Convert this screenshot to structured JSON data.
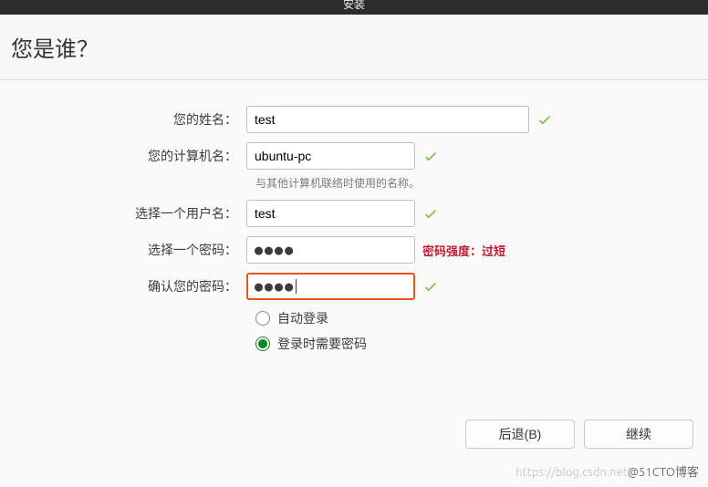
{
  "window": {
    "title": "安装"
  },
  "header": {
    "title": "您是谁？"
  },
  "form": {
    "name": {
      "label": "您的姓名：",
      "value": "test"
    },
    "hostname": {
      "label": "您的计算机名：",
      "value": "ubuntu-pc",
      "hint": "与其他计算机联络时使用的名称。"
    },
    "username": {
      "label": "选择一个用户名：",
      "value": "test"
    },
    "password": {
      "label": "选择一个密码：",
      "value": "●●●●",
      "strength_label": "密码强度：",
      "strength_value": "过短"
    },
    "confirm": {
      "label": "确认您的密码：",
      "value": "●●●●"
    },
    "login_options": {
      "auto": {
        "label": "自动登录",
        "selected": false
      },
      "require": {
        "label": "登录时需要密码",
        "selected": true
      }
    }
  },
  "buttons": {
    "back": "后退(B)",
    "continue": "继续"
  },
  "watermark": {
    "faint": "https://blog.csdn.net",
    "dark": "@51CTO博客"
  }
}
